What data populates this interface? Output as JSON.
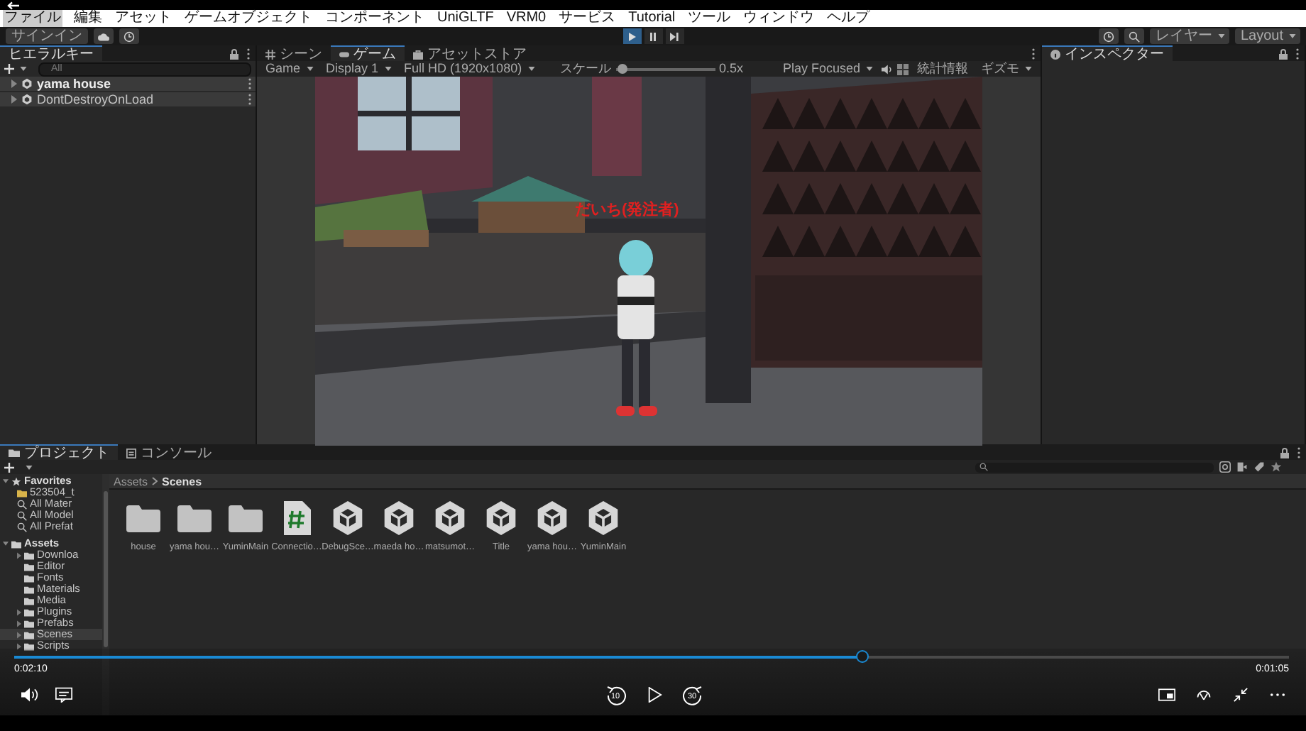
{
  "menu": [
    {
      "label": "ファイル",
      "selected": true
    },
    {
      "label": "編集",
      "selected": false
    },
    {
      "label": "アセット",
      "selected": false
    },
    {
      "label": "ゲームオブジェクト",
      "selected": false
    },
    {
      "label": "コンポーネント",
      "selected": false
    },
    {
      "label": "UniGLTF",
      "selected": false
    },
    {
      "label": "VRM0",
      "selected": false
    },
    {
      "label": "サービス",
      "selected": false
    },
    {
      "label": "Tutorial",
      "selected": false
    },
    {
      "label": "ツール",
      "selected": false
    },
    {
      "label": "ウィンドウ",
      "selected": false
    },
    {
      "label": "ヘルプ",
      "selected": false
    }
  ],
  "toolbar": {
    "sign_in": "サインイン",
    "play_controls": [
      {
        "kind": "play",
        "selected": true
      },
      {
        "kind": "pause",
        "selected": false
      },
      {
        "kind": "step",
        "selected": false
      }
    ],
    "layers": "レイヤー",
    "layout": "Layout"
  },
  "hierarchy": {
    "tab": "ヒエラルキー",
    "search_placeholder": "All",
    "items": [
      {
        "label": "yama house",
        "active": true
      },
      {
        "label": "DontDestroyOnLoad",
        "active": false
      }
    ]
  },
  "game": {
    "tabs": [
      {
        "label": "シーン",
        "kind": "scene",
        "selected": false
      },
      {
        "label": "ゲーム",
        "kind": "game",
        "selected": true
      },
      {
        "label": "アセットストア",
        "kind": "store",
        "selected": false
      }
    ],
    "display_mode": "Game",
    "display": "Display 1",
    "resolution": "Full HD (1920x1080)",
    "scale_label": "スケール",
    "scale": {
      "level": 0.03
    },
    "scale_value": "0.5x",
    "play_mode": "Play Focused",
    "stats": "統計情報",
    "gizmos": "ギズモ",
    "name_tag": "だいち(発注者)"
  },
  "inspector": {
    "tab": "インスペクター"
  },
  "project": {
    "tabs": [
      {
        "label": "プロジェクト",
        "kind": "project",
        "selected": true
      },
      {
        "label": "コンソール",
        "kind": "console",
        "selected": false
      }
    ],
    "favorites": {
      "label": "Favorites",
      "children": [
        {
          "label": "523504_t",
          "kind": "folder"
        },
        {
          "label": "All Mater",
          "kind": "search"
        },
        {
          "label": "All Model",
          "kind": "search"
        },
        {
          "label": "All Prefat",
          "kind": "search"
        }
      ]
    },
    "assets": {
      "label": "Assets",
      "children": [
        {
          "label": "Downloa",
          "expanded": false,
          "selected": false
        },
        {
          "label": "Editor",
          "selected": false
        },
        {
          "label": "Fonts",
          "selected": false
        },
        {
          "label": "Materials",
          "selected": false
        },
        {
          "label": "Media",
          "selected": false
        },
        {
          "label": "Plugins",
          "expanded": false,
          "selected": false
        },
        {
          "label": "Prefabs",
          "expanded": false,
          "selected": false
        },
        {
          "label": "Scenes",
          "expanded": false,
          "selected": true
        },
        {
          "label": "Scripts",
          "expanded": false,
          "selected": false
        }
      ]
    },
    "breadcrumb": [
      "Assets",
      "Scenes"
    ],
    "items": [
      {
        "kind": "folder",
        "label": "house"
      },
      {
        "kind": "folder",
        "label": "yama hou…"
      },
      {
        "kind": "folder",
        "label": "YuminMain"
      },
      {
        "kind": "script",
        "label": "Connectio…"
      },
      {
        "kind": "scene",
        "label": "DebugSce…"
      },
      {
        "kind": "scene",
        "label": "maeda ho…"
      },
      {
        "kind": "scene",
        "label": "matsumot…"
      },
      {
        "kind": "scene",
        "label": "Title"
      },
      {
        "kind": "scene",
        "label": "yama hou…"
      },
      {
        "kind": "scene",
        "label": "YuminMain"
      }
    ]
  },
  "video": {
    "progress": {
      "level": 0.666
    },
    "elapsed": "0:02:10",
    "remaining": "0:01:05",
    "rewind": "10",
    "forward": "30"
  }
}
